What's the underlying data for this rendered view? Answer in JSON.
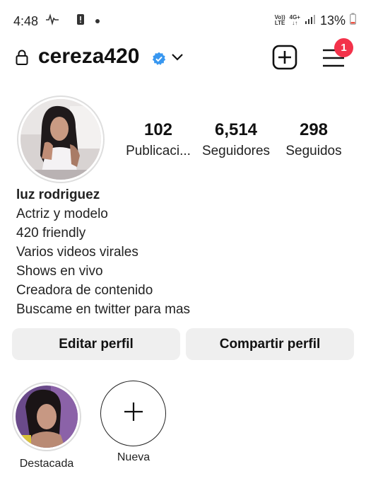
{
  "status": {
    "time": "4:48",
    "network_top": "Vo))",
    "network_bottom": "LTE",
    "network2_top": "4G+",
    "battery": "13%"
  },
  "header": {
    "username": "cereza420",
    "notification_count": "1"
  },
  "profile": {
    "stats": [
      {
        "value": "102",
        "label": "Publicaci..."
      },
      {
        "value": "6,514",
        "label": "Seguidores"
      },
      {
        "value": "298",
        "label": "Seguidos"
      }
    ],
    "name": "luz rodriguez",
    "bio": [
      "Actriz y modelo",
      "420 friendly",
      "Varios videos virales",
      "Shows en vivo",
      "Creadora de contenido",
      "Buscame en twitter para mas"
    ]
  },
  "actions": {
    "edit_label": "Editar perfil",
    "share_label": "Compartir perfil"
  },
  "highlights": [
    {
      "label": "Destacada"
    },
    {
      "label": "Nueva"
    }
  ],
  "colors": {
    "verified": "#3897f0",
    "notification": "#f3324a",
    "button_bg": "#efefef"
  }
}
